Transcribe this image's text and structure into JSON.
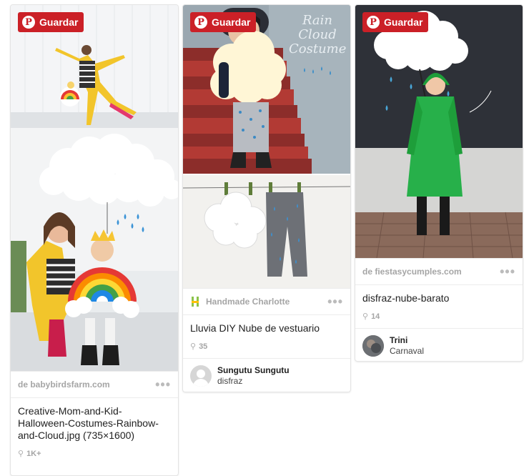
{
  "save_label": "Guardar",
  "pins": [
    {
      "source": "de babybirdsfarm.com",
      "description": "Creative-Mom-and-Kid-Halloween-Costumes-Rainbow-and-Cloud.jpg (735×1600)",
      "repins": "1K+"
    },
    {
      "image_text": "Rain Cloud Costume",
      "source": "Handmade Charlotte",
      "description": "Lluvia DIY Nube de vestuario",
      "repins": "35",
      "user": {
        "name": "Sungutu Sungutu",
        "board": "disfraz"
      }
    },
    {
      "source": "de fiestasycumples.com",
      "description": "disfraz-nube-barato",
      "repins": "14",
      "user": {
        "name": "Trini",
        "board": "Carnaval"
      }
    }
  ],
  "icons": {
    "save": "pinterest-p-icon",
    "more": "ellipsis-icon",
    "repin": "pushpin-icon",
    "avatar": "default-avatar-icon"
  },
  "colors": {
    "save_red": "#cb2027",
    "grey_text": "#a5a5a5"
  }
}
